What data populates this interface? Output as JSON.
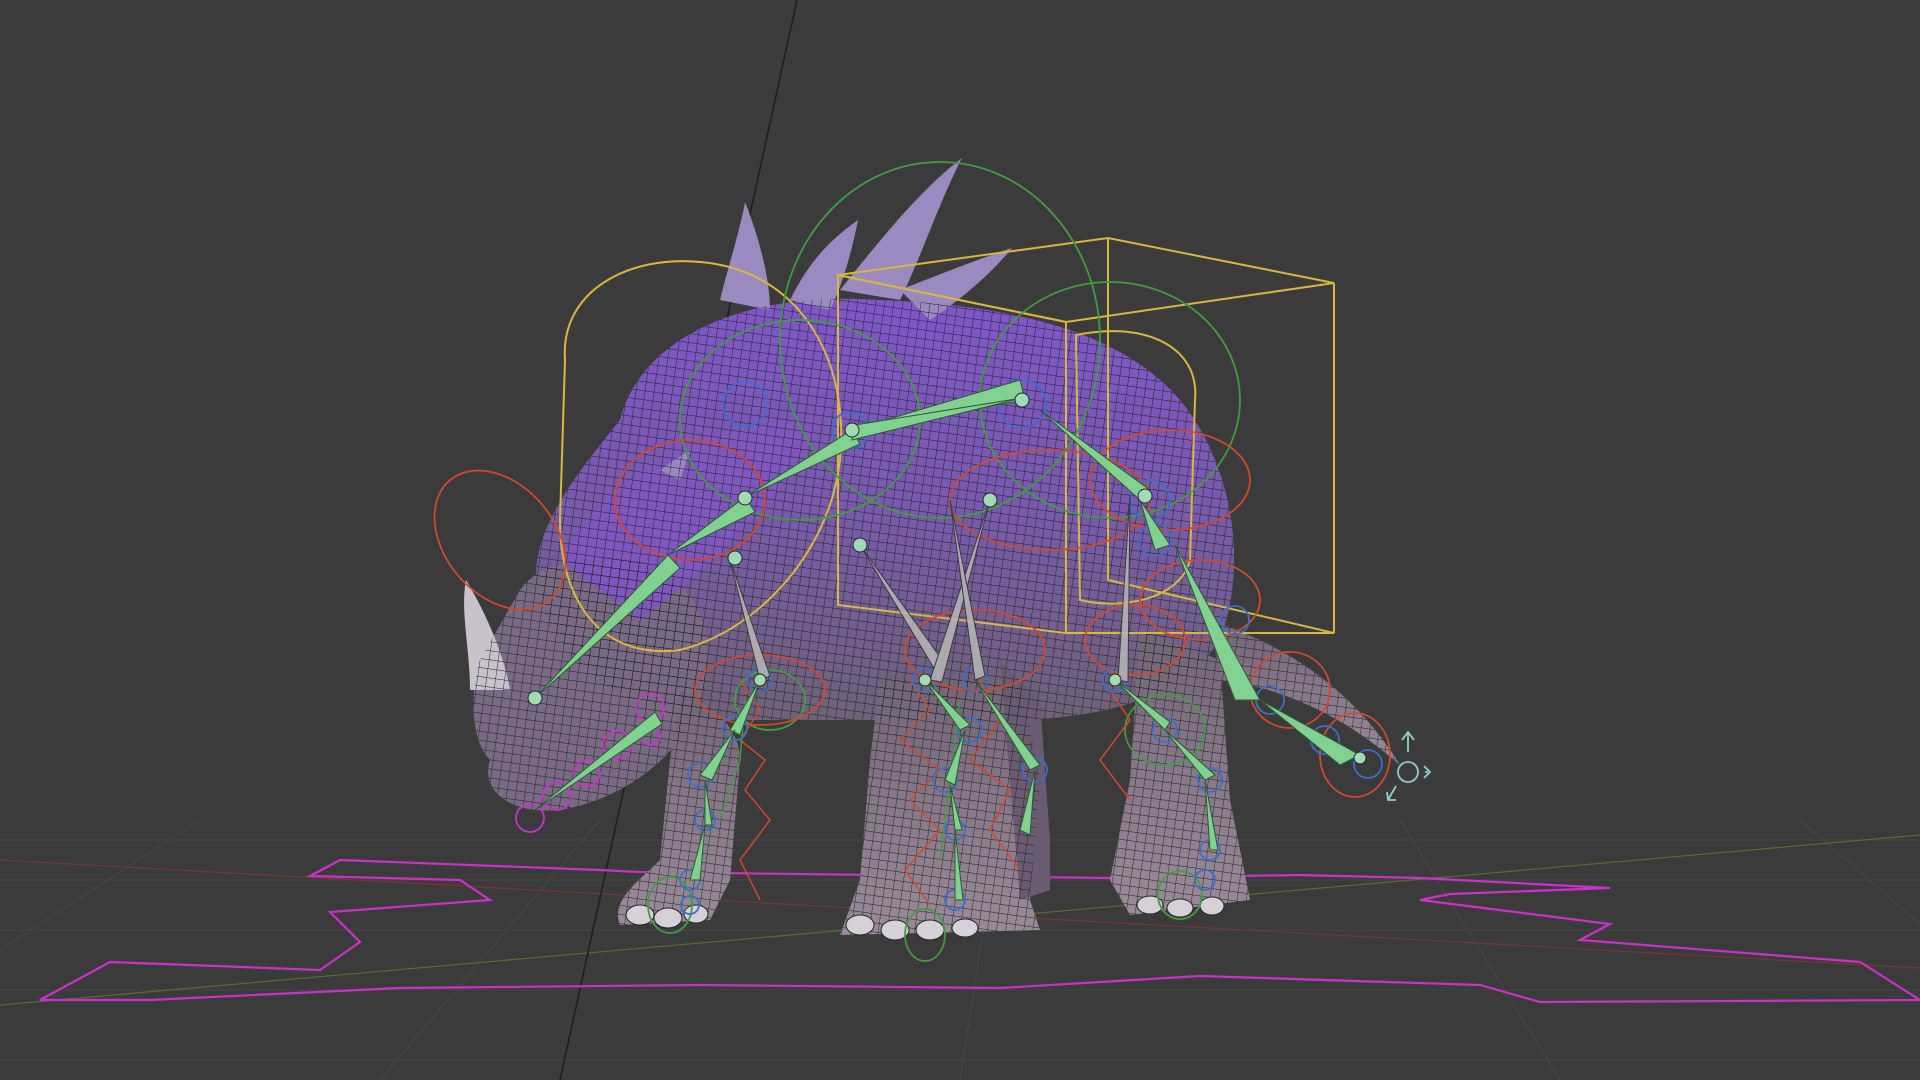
{
  "viewport": {
    "object_label": "",
    "background_color": "#3b3b3b",
    "grid_color": "#444444",
    "x_axis_color": "#8a3a3a",
    "y_axis_color": "#5a7a2f"
  },
  "scene": {
    "mesh_color": "#7a6a8a",
    "mesh_highlight": "#7a4fc4",
    "wire_color": "#222222",
    "bone_color": "#7fd38e",
    "bone_grey": "#bdbdbd",
    "ik_box_color": "#d9b73a",
    "control_green": "#3f9f3f",
    "control_red": "#d2492b",
    "control_blue": "#3a6ed1",
    "ground_control_color": "#d02fd0",
    "gizmo_color": "#8ecfd0",
    "gizmo_icon": "move-gizmo-icon"
  }
}
